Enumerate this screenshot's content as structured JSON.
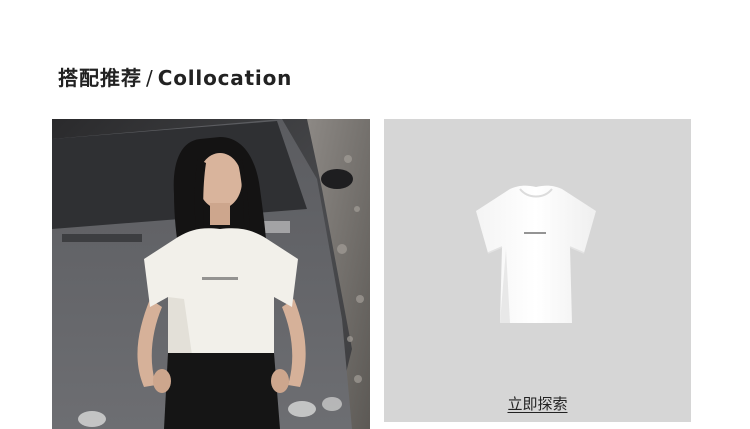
{
  "section": {
    "title_cn": "搭配推荐",
    "separator": "/",
    "title_en": "Collocation"
  },
  "model_image": {
    "icon": "model-photo"
  },
  "product": {
    "icon": "white-tshirt",
    "explore_label": "立即探索"
  },
  "colors": {
    "panel_bg": "#d6d6d6",
    "title": "#222222"
  }
}
